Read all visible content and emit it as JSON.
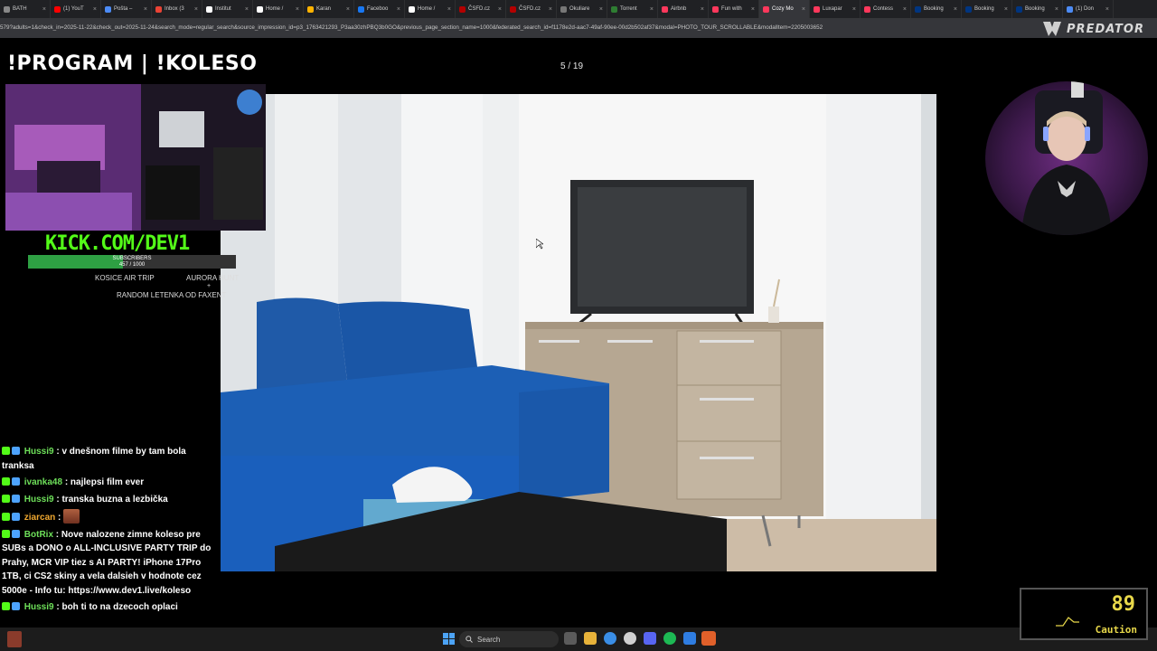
{
  "browser": {
    "tabs": [
      {
        "label": "BATH",
        "color": "#888888"
      },
      {
        "label": "(1) YouT",
        "color": "#ff0000"
      },
      {
        "label": "Pošta –",
        "color": "#4c8bf5"
      },
      {
        "label": "Inbox (3",
        "color": "#ea4335"
      },
      {
        "label": "Institut",
        "color": "#ffffff"
      },
      {
        "label": "Home /",
        "color": "#ffffff"
      },
      {
        "label": "Karan",
        "color": "#ffb300"
      },
      {
        "label": "Faceboo",
        "color": "#1877f2"
      },
      {
        "label": "Home /",
        "color": "#ffffff"
      },
      {
        "label": "ČSFD.cz",
        "color": "#b40000"
      },
      {
        "label": "ČSFD.cz",
        "color": "#b40000"
      },
      {
        "label": "Okuliare",
        "color": "#777777"
      },
      {
        "label": "Torrent",
        "color": "#2e7d32"
      },
      {
        "label": "Airbnb",
        "color": "#ff385c"
      },
      {
        "label": "Fun with",
        "color": "#ff385c"
      },
      {
        "label": "Cozy Mo",
        "color": "#ff385c"
      },
      {
        "label": "Luxapar",
        "color": "#ff385c"
      },
      {
        "label": "Contess",
        "color": "#ff385c"
      },
      {
        "label": "Booking",
        "color": "#003580"
      },
      {
        "label": "Booking",
        "color": "#003580"
      },
      {
        "label": "Booking",
        "color": "#003580"
      },
      {
        "label": "(1) Don",
        "color": "#4c8bf5"
      }
    ],
    "active_tab_index": 15,
    "url": "579?adults=1&check_in=2025-11-22&check_out=2025-11-24&search_mode=regular_search&source_impression_id=p3_1763421293_P3aa30zhPBQ3b0GO&previous_page_section_name=1000&federated_search_id=f1178e2d-aac7-49af-90ee-00d2b502af37&modal=PHOTO_TOUR_SCROLLABLE&modalItem=2205003652"
  },
  "brand": {
    "name": "PREDATOR"
  },
  "overlay": {
    "title": "!PROGRAM | !KOLESO",
    "kick_text": "KICK.COM/DEV1",
    "subs_label": "SUBSCRIBERS",
    "subs_count": "457 / 1000",
    "subs_progress": 0.457,
    "goals": [
      "KOSICE AIR TRIP",
      "AURORA HUNT",
      "+",
      "RANDOM LETENKA OD FAXENT"
    ]
  },
  "gallery": {
    "counter": "5 / 19"
  },
  "chat": {
    "messages": [
      {
        "user": "Hussi9",
        "user_color": "#6ee05a",
        "text": ": v dnešnom filme by tam bola tranksa"
      },
      {
        "user": "ivanka48",
        "user_color": "#6ee05a",
        "text": ": najlepsi film ever"
      },
      {
        "user": "Hussi9",
        "user_color": "#6ee05a",
        "text": ": transka buzna a lezbička"
      },
      {
        "user": "ziarcan",
        "user_color": "#f0a830",
        "text": ":"
      },
      {
        "user": "BotRix",
        "user_color": "#6ee05a",
        "text": ": Nove nalozene zimne koleso pre SUBs a DONO o ALL-INCLUSIVE PARTY TRIP do Prahy, MCR VIP tiez s AI PARTY! iPhone 17Pro 1TB, ci CS2 skiny a vela dalsieh v hodnote cez 5000e - Info tu: https://www.dev1.live/koleso"
      },
      {
        "user": "Hussi9",
        "user_color": "#6ee05a",
        "text": ": boh ti to na dzecoch oplaci"
      }
    ]
  },
  "taskbar": {
    "search_placeholder": "Search"
  },
  "widget": {
    "value": "89",
    "label": "Caution",
    "color": "#e8d84a"
  }
}
